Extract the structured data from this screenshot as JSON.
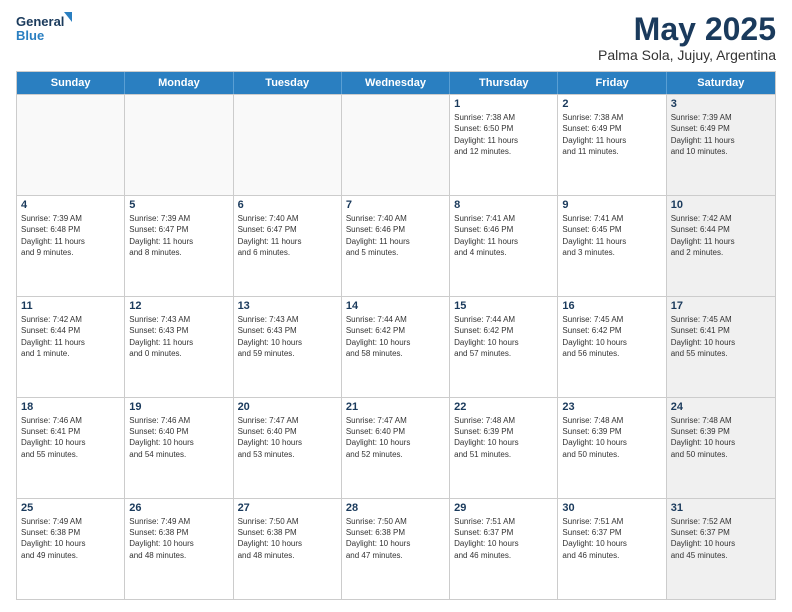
{
  "logo": {
    "line1": "General",
    "line2": "Blue"
  },
  "title": "May 2025",
  "subtitle": "Palma Sola, Jujuy, Argentina",
  "days": [
    "Sunday",
    "Monday",
    "Tuesday",
    "Wednesday",
    "Thursday",
    "Friday",
    "Saturday"
  ],
  "weeks": [
    [
      {
        "day": "",
        "info": "",
        "empty": true
      },
      {
        "day": "",
        "info": "",
        "empty": true
      },
      {
        "day": "",
        "info": "",
        "empty": true
      },
      {
        "day": "",
        "info": "",
        "empty": true
      },
      {
        "day": "1",
        "info": "Sunrise: 7:38 AM\nSunset: 6:50 PM\nDaylight: 11 hours\nand 12 minutes."
      },
      {
        "day": "2",
        "info": "Sunrise: 7:38 AM\nSunset: 6:49 PM\nDaylight: 11 hours\nand 11 minutes."
      },
      {
        "day": "3",
        "info": "Sunrise: 7:39 AM\nSunset: 6:49 PM\nDaylight: 11 hours\nand 10 minutes.",
        "shaded": true
      }
    ],
    [
      {
        "day": "4",
        "info": "Sunrise: 7:39 AM\nSunset: 6:48 PM\nDaylight: 11 hours\nand 9 minutes."
      },
      {
        "day": "5",
        "info": "Sunrise: 7:39 AM\nSunset: 6:47 PM\nDaylight: 11 hours\nand 8 minutes."
      },
      {
        "day": "6",
        "info": "Sunrise: 7:40 AM\nSunset: 6:47 PM\nDaylight: 11 hours\nand 6 minutes."
      },
      {
        "day": "7",
        "info": "Sunrise: 7:40 AM\nSunset: 6:46 PM\nDaylight: 11 hours\nand 5 minutes."
      },
      {
        "day": "8",
        "info": "Sunrise: 7:41 AM\nSunset: 6:46 PM\nDaylight: 11 hours\nand 4 minutes."
      },
      {
        "day": "9",
        "info": "Sunrise: 7:41 AM\nSunset: 6:45 PM\nDaylight: 11 hours\nand 3 minutes."
      },
      {
        "day": "10",
        "info": "Sunrise: 7:42 AM\nSunset: 6:44 PM\nDaylight: 11 hours\nand 2 minutes.",
        "shaded": true
      }
    ],
    [
      {
        "day": "11",
        "info": "Sunrise: 7:42 AM\nSunset: 6:44 PM\nDaylight: 11 hours\nand 1 minute."
      },
      {
        "day": "12",
        "info": "Sunrise: 7:43 AM\nSunset: 6:43 PM\nDaylight: 11 hours\nand 0 minutes."
      },
      {
        "day": "13",
        "info": "Sunrise: 7:43 AM\nSunset: 6:43 PM\nDaylight: 10 hours\nand 59 minutes."
      },
      {
        "day": "14",
        "info": "Sunrise: 7:44 AM\nSunset: 6:42 PM\nDaylight: 10 hours\nand 58 minutes."
      },
      {
        "day": "15",
        "info": "Sunrise: 7:44 AM\nSunset: 6:42 PM\nDaylight: 10 hours\nand 57 minutes."
      },
      {
        "day": "16",
        "info": "Sunrise: 7:45 AM\nSunset: 6:42 PM\nDaylight: 10 hours\nand 56 minutes."
      },
      {
        "day": "17",
        "info": "Sunrise: 7:45 AM\nSunset: 6:41 PM\nDaylight: 10 hours\nand 55 minutes.",
        "shaded": true
      }
    ],
    [
      {
        "day": "18",
        "info": "Sunrise: 7:46 AM\nSunset: 6:41 PM\nDaylight: 10 hours\nand 55 minutes."
      },
      {
        "day": "19",
        "info": "Sunrise: 7:46 AM\nSunset: 6:40 PM\nDaylight: 10 hours\nand 54 minutes."
      },
      {
        "day": "20",
        "info": "Sunrise: 7:47 AM\nSunset: 6:40 PM\nDaylight: 10 hours\nand 53 minutes."
      },
      {
        "day": "21",
        "info": "Sunrise: 7:47 AM\nSunset: 6:40 PM\nDaylight: 10 hours\nand 52 minutes."
      },
      {
        "day": "22",
        "info": "Sunrise: 7:48 AM\nSunset: 6:39 PM\nDaylight: 10 hours\nand 51 minutes."
      },
      {
        "day": "23",
        "info": "Sunrise: 7:48 AM\nSunset: 6:39 PM\nDaylight: 10 hours\nand 50 minutes."
      },
      {
        "day": "24",
        "info": "Sunrise: 7:48 AM\nSunset: 6:39 PM\nDaylight: 10 hours\nand 50 minutes.",
        "shaded": true
      }
    ],
    [
      {
        "day": "25",
        "info": "Sunrise: 7:49 AM\nSunset: 6:38 PM\nDaylight: 10 hours\nand 49 minutes."
      },
      {
        "day": "26",
        "info": "Sunrise: 7:49 AM\nSunset: 6:38 PM\nDaylight: 10 hours\nand 48 minutes."
      },
      {
        "day": "27",
        "info": "Sunrise: 7:50 AM\nSunset: 6:38 PM\nDaylight: 10 hours\nand 48 minutes."
      },
      {
        "day": "28",
        "info": "Sunrise: 7:50 AM\nSunset: 6:38 PM\nDaylight: 10 hours\nand 47 minutes."
      },
      {
        "day": "29",
        "info": "Sunrise: 7:51 AM\nSunset: 6:37 PM\nDaylight: 10 hours\nand 46 minutes."
      },
      {
        "day": "30",
        "info": "Sunrise: 7:51 AM\nSunset: 6:37 PM\nDaylight: 10 hours\nand 46 minutes."
      },
      {
        "day": "31",
        "info": "Sunrise: 7:52 AM\nSunset: 6:37 PM\nDaylight: 10 hours\nand 45 minutes.",
        "shaded": true
      }
    ]
  ]
}
